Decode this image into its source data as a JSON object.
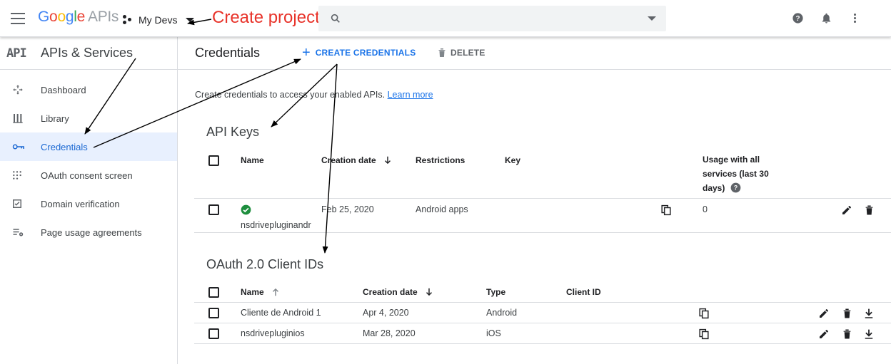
{
  "topbar": {
    "logo_letters": [
      "G",
      "o",
      "o",
      "g",
      "l",
      "e"
    ],
    "logo_suffix": "APIs",
    "project_name": "My Devs",
    "annotation": "Create project"
  },
  "sidebar": {
    "badge": "API",
    "title": "APIs & Services",
    "items": [
      {
        "label": "Dashboard",
        "icon": "dashboard-icon"
      },
      {
        "label": "Library",
        "icon": "library-icon"
      },
      {
        "label": "Credentials",
        "icon": "key-icon",
        "active": true
      },
      {
        "label": "OAuth consent screen",
        "icon": "oauth-consent-icon"
      },
      {
        "label": "Domain verification",
        "icon": "checkbox-icon"
      },
      {
        "label": "Page usage agreements",
        "icon": "settings-list-icon"
      }
    ]
  },
  "main": {
    "title": "Credentials",
    "create_label": "CREATE CREDENTIALS",
    "delete_label": "DELETE",
    "intro_text": "Create credentials to access your enabled APIs.",
    "learn_more": "Learn more"
  },
  "api_keys": {
    "title": "API Keys",
    "headers": {
      "name": "Name",
      "creation": "Creation date",
      "restrictions": "Restrictions",
      "key": "Key",
      "usage": [
        "Usage with all",
        "services (last 30",
        "days)"
      ]
    },
    "rows": [
      {
        "name": "nsdrivepluginandr",
        "date": "Feb 25, 2020",
        "restrictions": "Android apps",
        "usage": "0"
      }
    ]
  },
  "oauth": {
    "title": "OAuth 2.0 Client IDs",
    "headers": {
      "name": "Name",
      "creation": "Creation date",
      "type": "Type",
      "client_id": "Client ID"
    },
    "rows": [
      {
        "name": "Cliente de Android 1",
        "date": "Apr 4, 2020",
        "type": "Android"
      },
      {
        "name": "nsdrivepluginios",
        "date": "Mar 28, 2020",
        "type": "iOS"
      }
    ]
  },
  "colors": {
    "accent": "#1a73e8",
    "annotation": "#e8332a",
    "success": "#1e8e3e",
    "active_bg": "#e8f0fe"
  }
}
